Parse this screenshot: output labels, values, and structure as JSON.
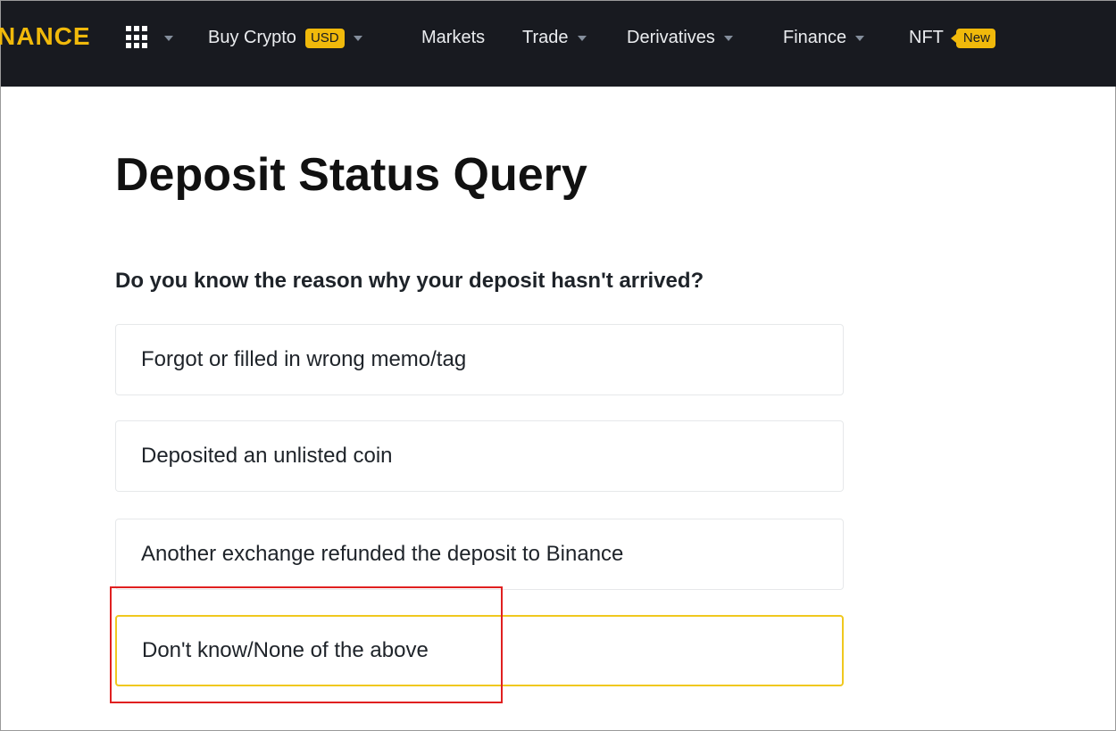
{
  "nav": {
    "logo": "NANCE",
    "items": [
      {
        "label": "Buy Crypto",
        "badge": "USD"
      },
      {
        "label": "Markets"
      },
      {
        "label": "Trade"
      },
      {
        "label": "Derivatives"
      },
      {
        "label": "Finance"
      },
      {
        "label": "NFT",
        "badge": "New"
      }
    ]
  },
  "page": {
    "title": "Deposit Status Query",
    "question": "Do you know the reason why your deposit hasn't arrived?",
    "options": [
      {
        "label": "Forgot or filled in wrong memo/tag"
      },
      {
        "label": "Deposited an unlisted coin"
      },
      {
        "label": "Another exchange refunded the deposit to Binance"
      },
      {
        "label": "Don't know/None of the above",
        "selected": true
      }
    ]
  },
  "colors": {
    "topbar": "#181a20",
    "accent": "#f0b90b",
    "annotation": "#e02020"
  }
}
